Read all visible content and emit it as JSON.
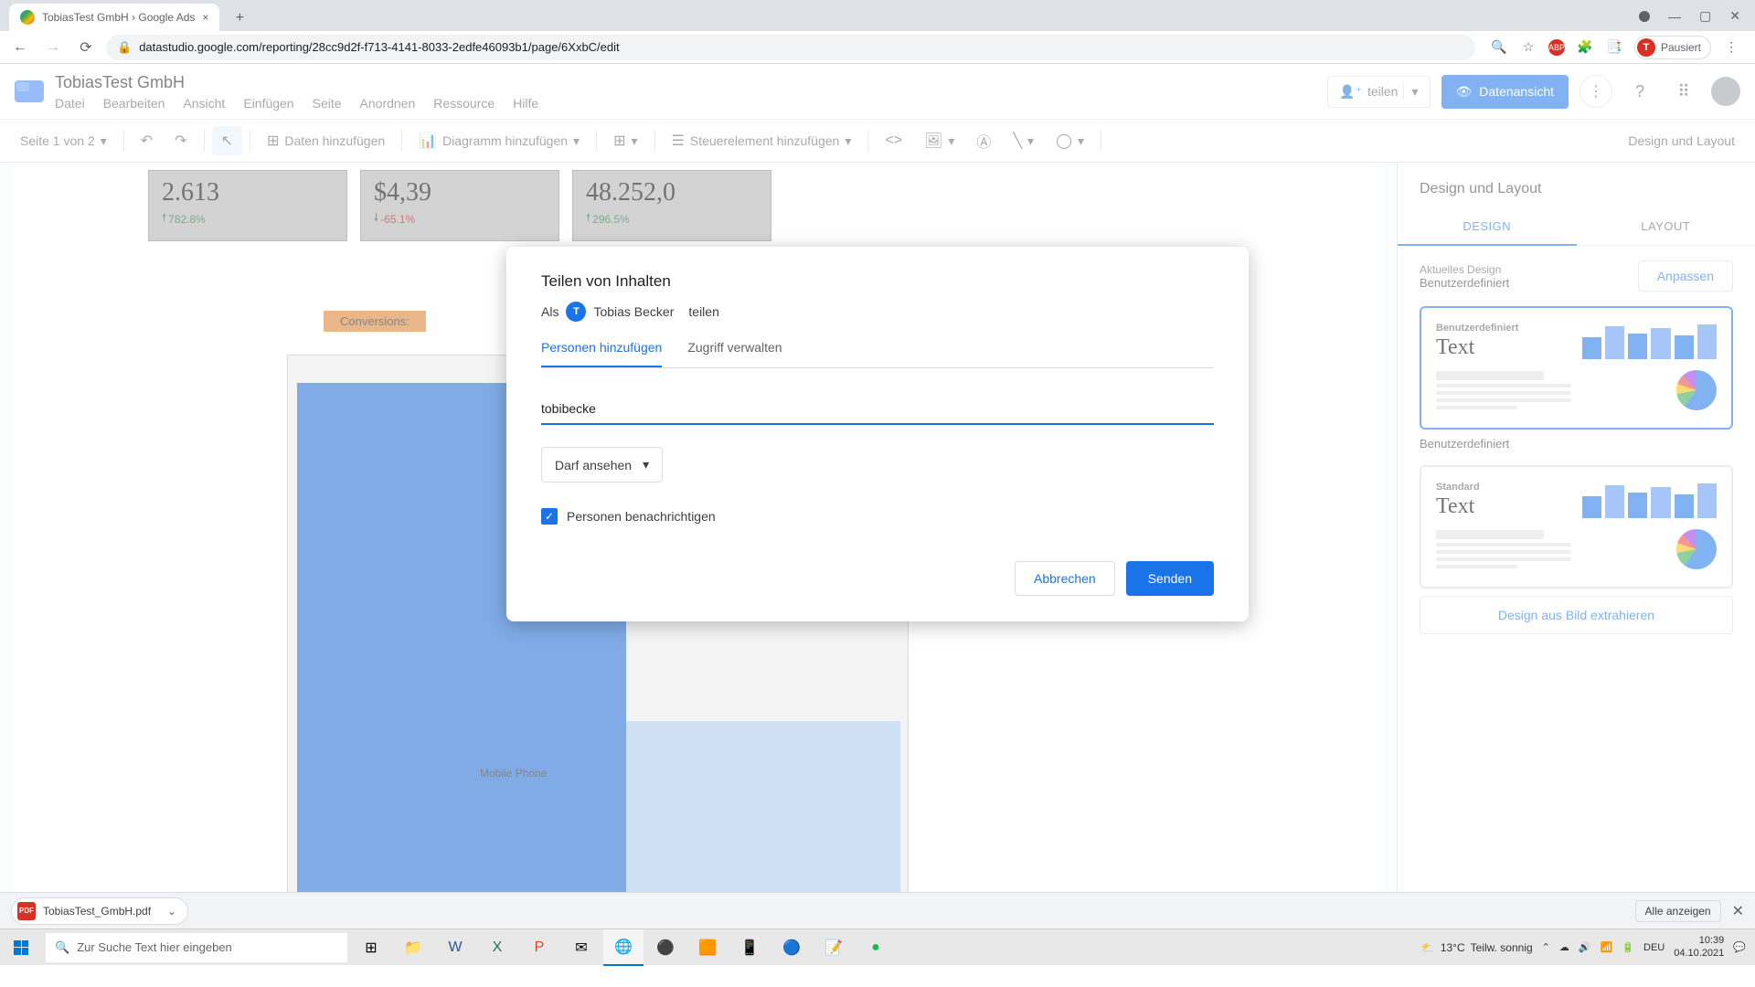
{
  "browser": {
    "tab_title": "TobiasTest GmbH › Google Ads",
    "url": "datastudio.google.com/reporting/28cc9d2f-f713-4141-8033-2edfe46093b1/page/6XxbC/edit",
    "profile_status": "Pausiert",
    "profile_initial": "T"
  },
  "app": {
    "title": "TobiasTest GmbH",
    "menu": [
      "Datei",
      "Bearbeiten",
      "Ansicht",
      "Einfügen",
      "Seite",
      "Anordnen",
      "Ressource",
      "Hilfe"
    ],
    "share_label": "teilen",
    "view_label": "Datenansicht"
  },
  "toolbar": {
    "page_indicator": "Seite 1 von 2",
    "add_data": "Daten hinzufügen",
    "add_chart": "Diagramm hinzufügen",
    "add_control": "Steuerelement hinzufügen",
    "design_layout": "Design und Layout"
  },
  "canvas": {
    "metrics": [
      {
        "value": "2.613",
        "change": "782.8%",
        "dir": "up"
      },
      {
        "value": "$4,39",
        "change": "-65.1%",
        "dir": "down"
      },
      {
        "value": "48.252,0",
        "change": "296.5%",
        "dir": "up"
      }
    ],
    "conversions_label": "Conversions:",
    "chart_label": "Mobile Phone"
  },
  "panel": {
    "title": "Design und Layout",
    "tab_design": "DESIGN",
    "tab_layout": "LAYOUT",
    "current_design_label": "Aktuelles Design",
    "current_design_name": "Benutzerdefiniert",
    "adjust": "Anpassen",
    "theme1_title": "Benutzerdefiniert",
    "theme1_text": "Text",
    "theme1_caption": "Benutzerdefiniert",
    "theme2_title": "Standard",
    "theme2_text": "Text",
    "extract": "Design aus Bild extrahieren"
  },
  "modal": {
    "title": "Teilen von Inhalten",
    "as_label": "Als",
    "user_name": "Tobias Becker",
    "share_word": "teilen",
    "tab_add": "Personen hinzufügen",
    "tab_manage": "Zugriff verwalten",
    "email_value": "tobibecke",
    "permission": "Darf ansehen",
    "notify": "Personen benachrichtigen",
    "cancel": "Abbrechen",
    "send": "Senden"
  },
  "downloads": {
    "file": "TobiasTest_GmbH.pdf",
    "show_all": "Alle anzeigen"
  },
  "taskbar": {
    "search_placeholder": "Zur Suche Text hier eingeben",
    "weather_temp": "13°C",
    "weather_desc": "Teilw. sonnig",
    "lang": "DEU",
    "time": "10:39",
    "date": "04.10.2021"
  }
}
